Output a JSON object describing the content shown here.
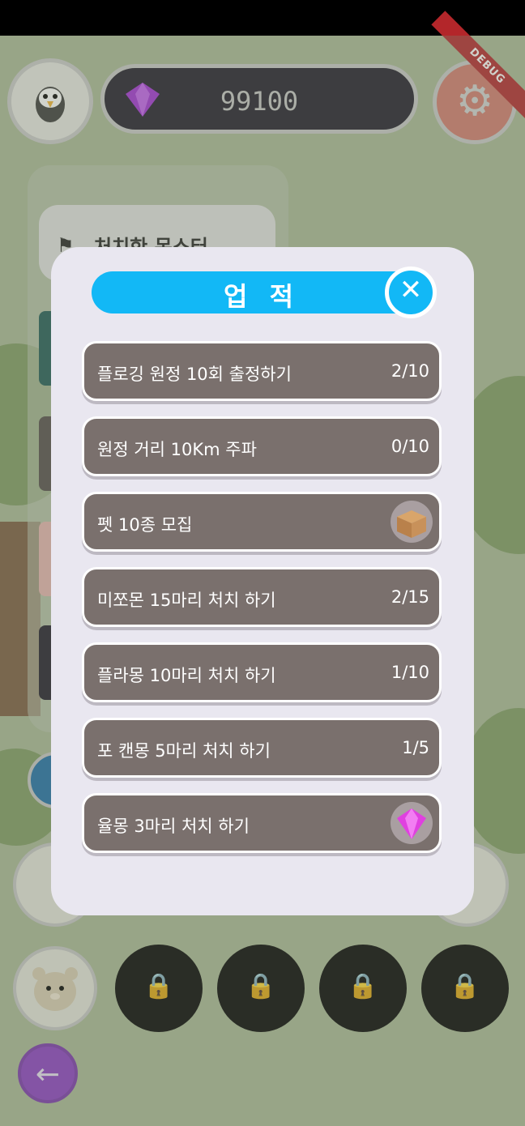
{
  "debug_banner": "DEBUG",
  "gems": {
    "count": "99100",
    "color": "#a12fd6"
  },
  "side_panel": {
    "tab_label": "처치한 몬스터"
  },
  "modal": {
    "title": "업 적",
    "header_color": "#12b8f6",
    "achievements": [
      {
        "label": "플로깅 원정 10회 출정하기",
        "progress": "2/10",
        "reward": null
      },
      {
        "label": "원정 거리 10Km 주파",
        "progress": "0/10",
        "reward": null
      },
      {
        "label": "펫 10종 모집",
        "progress": "",
        "reward": "box-icon"
      },
      {
        "label": "미쪼몬 15마리 처치 하기",
        "progress": "2/15",
        "reward": null
      },
      {
        "label": "플라몽 10마리 처치 하기",
        "progress": "1/10",
        "reward": null
      },
      {
        "label": "포 캔몽 5마리 처치 하기",
        "progress": "1/5",
        "reward": null
      },
      {
        "label": "율몽 3마리 처치 하기",
        "progress": "",
        "reward": "gem-icon"
      }
    ]
  },
  "icons": {
    "settings": "gear-icon",
    "back": "arrow-left-icon",
    "lock": "lock-icon",
    "close": "close-icon"
  }
}
